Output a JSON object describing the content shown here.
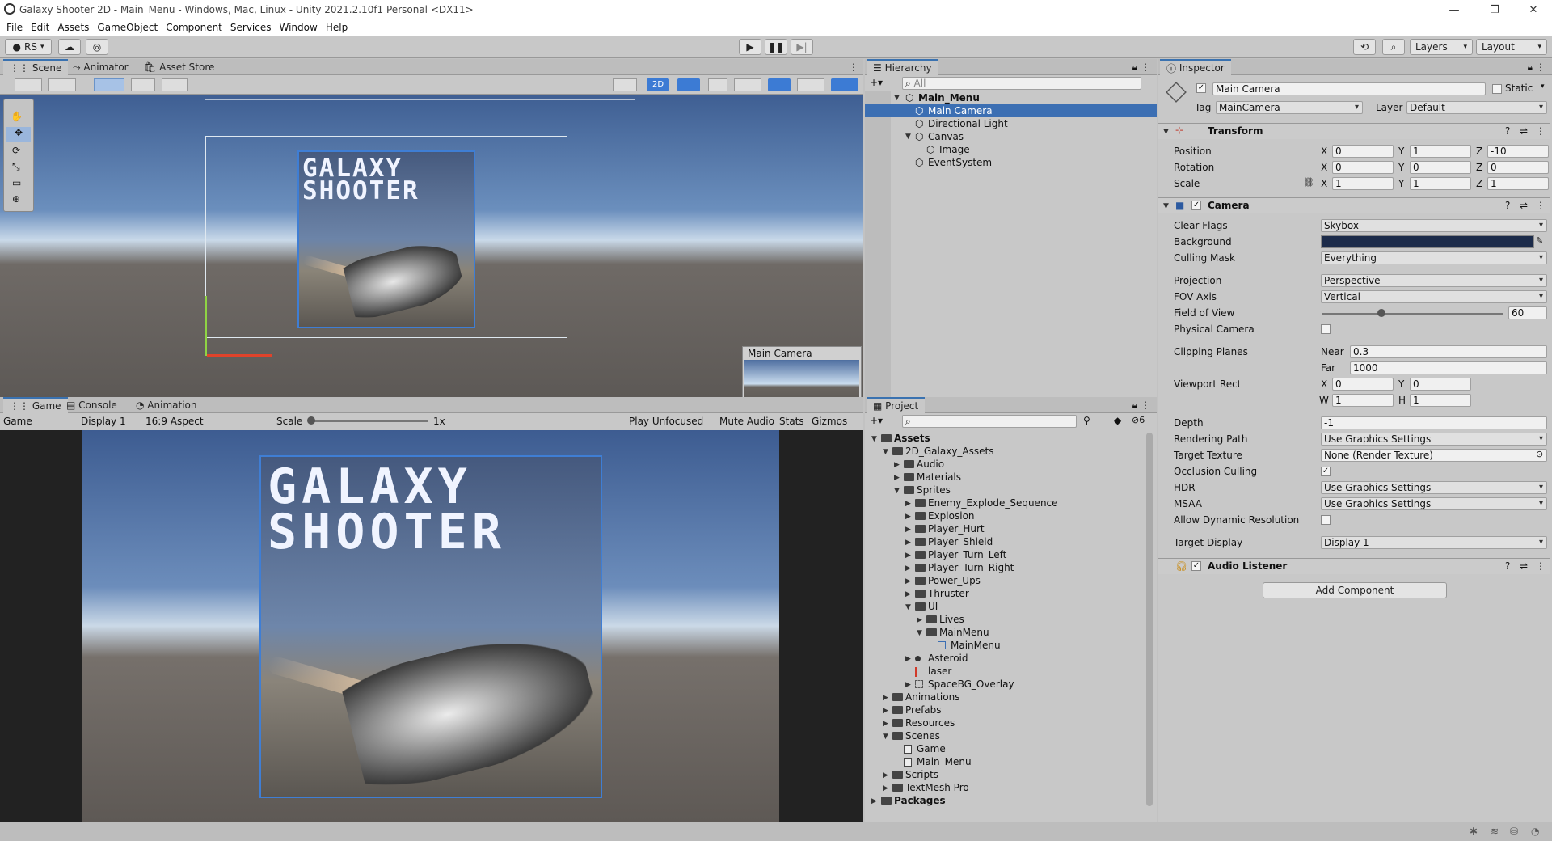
{
  "window": {
    "title": "Galaxy Shooter 2D - Main_Menu - Windows, Mac, Linux - Unity 2021.2.10f1 Personal <DX11>"
  },
  "menu": [
    "File",
    "Edit",
    "Assets",
    "GameObject",
    "Component",
    "Services",
    "Window",
    "Help"
  ],
  "toolbar": {
    "account": "RS",
    "layers": "Layers",
    "layout": "Layout"
  },
  "scene": {
    "tabs": [
      "Scene",
      "Animator",
      "Asset Store"
    ],
    "mode2d": "2D",
    "game_title_line1": "GALAXY",
    "game_title_line2": "SHOOTER",
    "camera_preview": "Main Camera"
  },
  "game": {
    "tabs": [
      "Game",
      "Console",
      "Animation"
    ],
    "display_select": "Game",
    "display": "Display 1",
    "aspect": "16:9 Aspect",
    "scale_label": "Scale",
    "scale_value": "1x",
    "play_mode": "Play Unfocused",
    "mute": "Mute Audio",
    "stats": "Stats",
    "gizmos": "Gizmos"
  },
  "hierarchy": {
    "title": "Hierarchy",
    "search_placeholder": "All",
    "items": [
      "Main_Menu",
      "Main Camera",
      "Directional Light",
      "Canvas",
      "Image",
      "EventSystem"
    ]
  },
  "project": {
    "title": "Project",
    "badge": "6",
    "items": [
      "Assets",
      "2D_Galaxy_Assets",
      "Audio",
      "Materials",
      "Sprites",
      "Enemy_Explode_Sequence",
      "Explosion",
      "Player_Hurt",
      "Player_Shield",
      "Player_Turn_Left",
      "Player_Turn_Right",
      "Power_Ups",
      "Thruster",
      "UI",
      "Lives",
      "MainMenu",
      "MainMenu",
      "Asteroid",
      "laser",
      "SpaceBG_Overlay",
      "Animations",
      "Prefabs",
      "Resources",
      "Scenes",
      "Game",
      "Main_Menu",
      "Scripts",
      "TextMesh Pro",
      "Packages"
    ]
  },
  "inspector": {
    "title": "Inspector",
    "object_name": "Main Camera",
    "static_label": "Static",
    "tag_label": "Tag",
    "tag": "MainCamera",
    "layer_label": "Layer",
    "layer": "Default",
    "transform": {
      "title": "Transform",
      "position_label": "Position",
      "rotation_label": "Rotation",
      "scale_label": "Scale",
      "position": [
        "0",
        "1",
        "-10"
      ],
      "rotation": [
        "0",
        "0",
        "0"
      ],
      "scale": [
        "1",
        "1",
        "1"
      ]
    },
    "axis": [
      "X",
      "Y",
      "Z",
      "W",
      "H"
    ],
    "camera": {
      "title": "Camera",
      "labels": [
        "Clear Flags",
        "Background",
        "Culling Mask",
        "Projection",
        "FOV Axis",
        "Field of View",
        "Physical Camera",
        "Clipping Planes",
        "Viewport Rect",
        "Depth",
        "Rendering Path",
        "Target Texture",
        "Occlusion Culling",
        "HDR",
        "MSAA",
        "Allow Dynamic Resolution",
        "Target Display"
      ],
      "clear_flags": "Skybox",
      "culling_mask": "Everything",
      "projection": "Perspective",
      "fov_axis": "Vertical",
      "fov": "60",
      "near_label": "Near",
      "near": "0.3",
      "far_label": "Far",
      "far": "1000",
      "viewport": [
        "0",
        "0",
        "1",
        "1"
      ],
      "depth": "-1",
      "rendering_path": "Use Graphics Settings",
      "target_texture": "None (Render Texture)",
      "hdr": "Use Graphics Settings",
      "msaa": "Use Graphics Settings",
      "target_display": "Display 1",
      "background_color": "#1c2b4a"
    },
    "audio_listener": "Audio Listener",
    "add_component": "Add Component"
  }
}
